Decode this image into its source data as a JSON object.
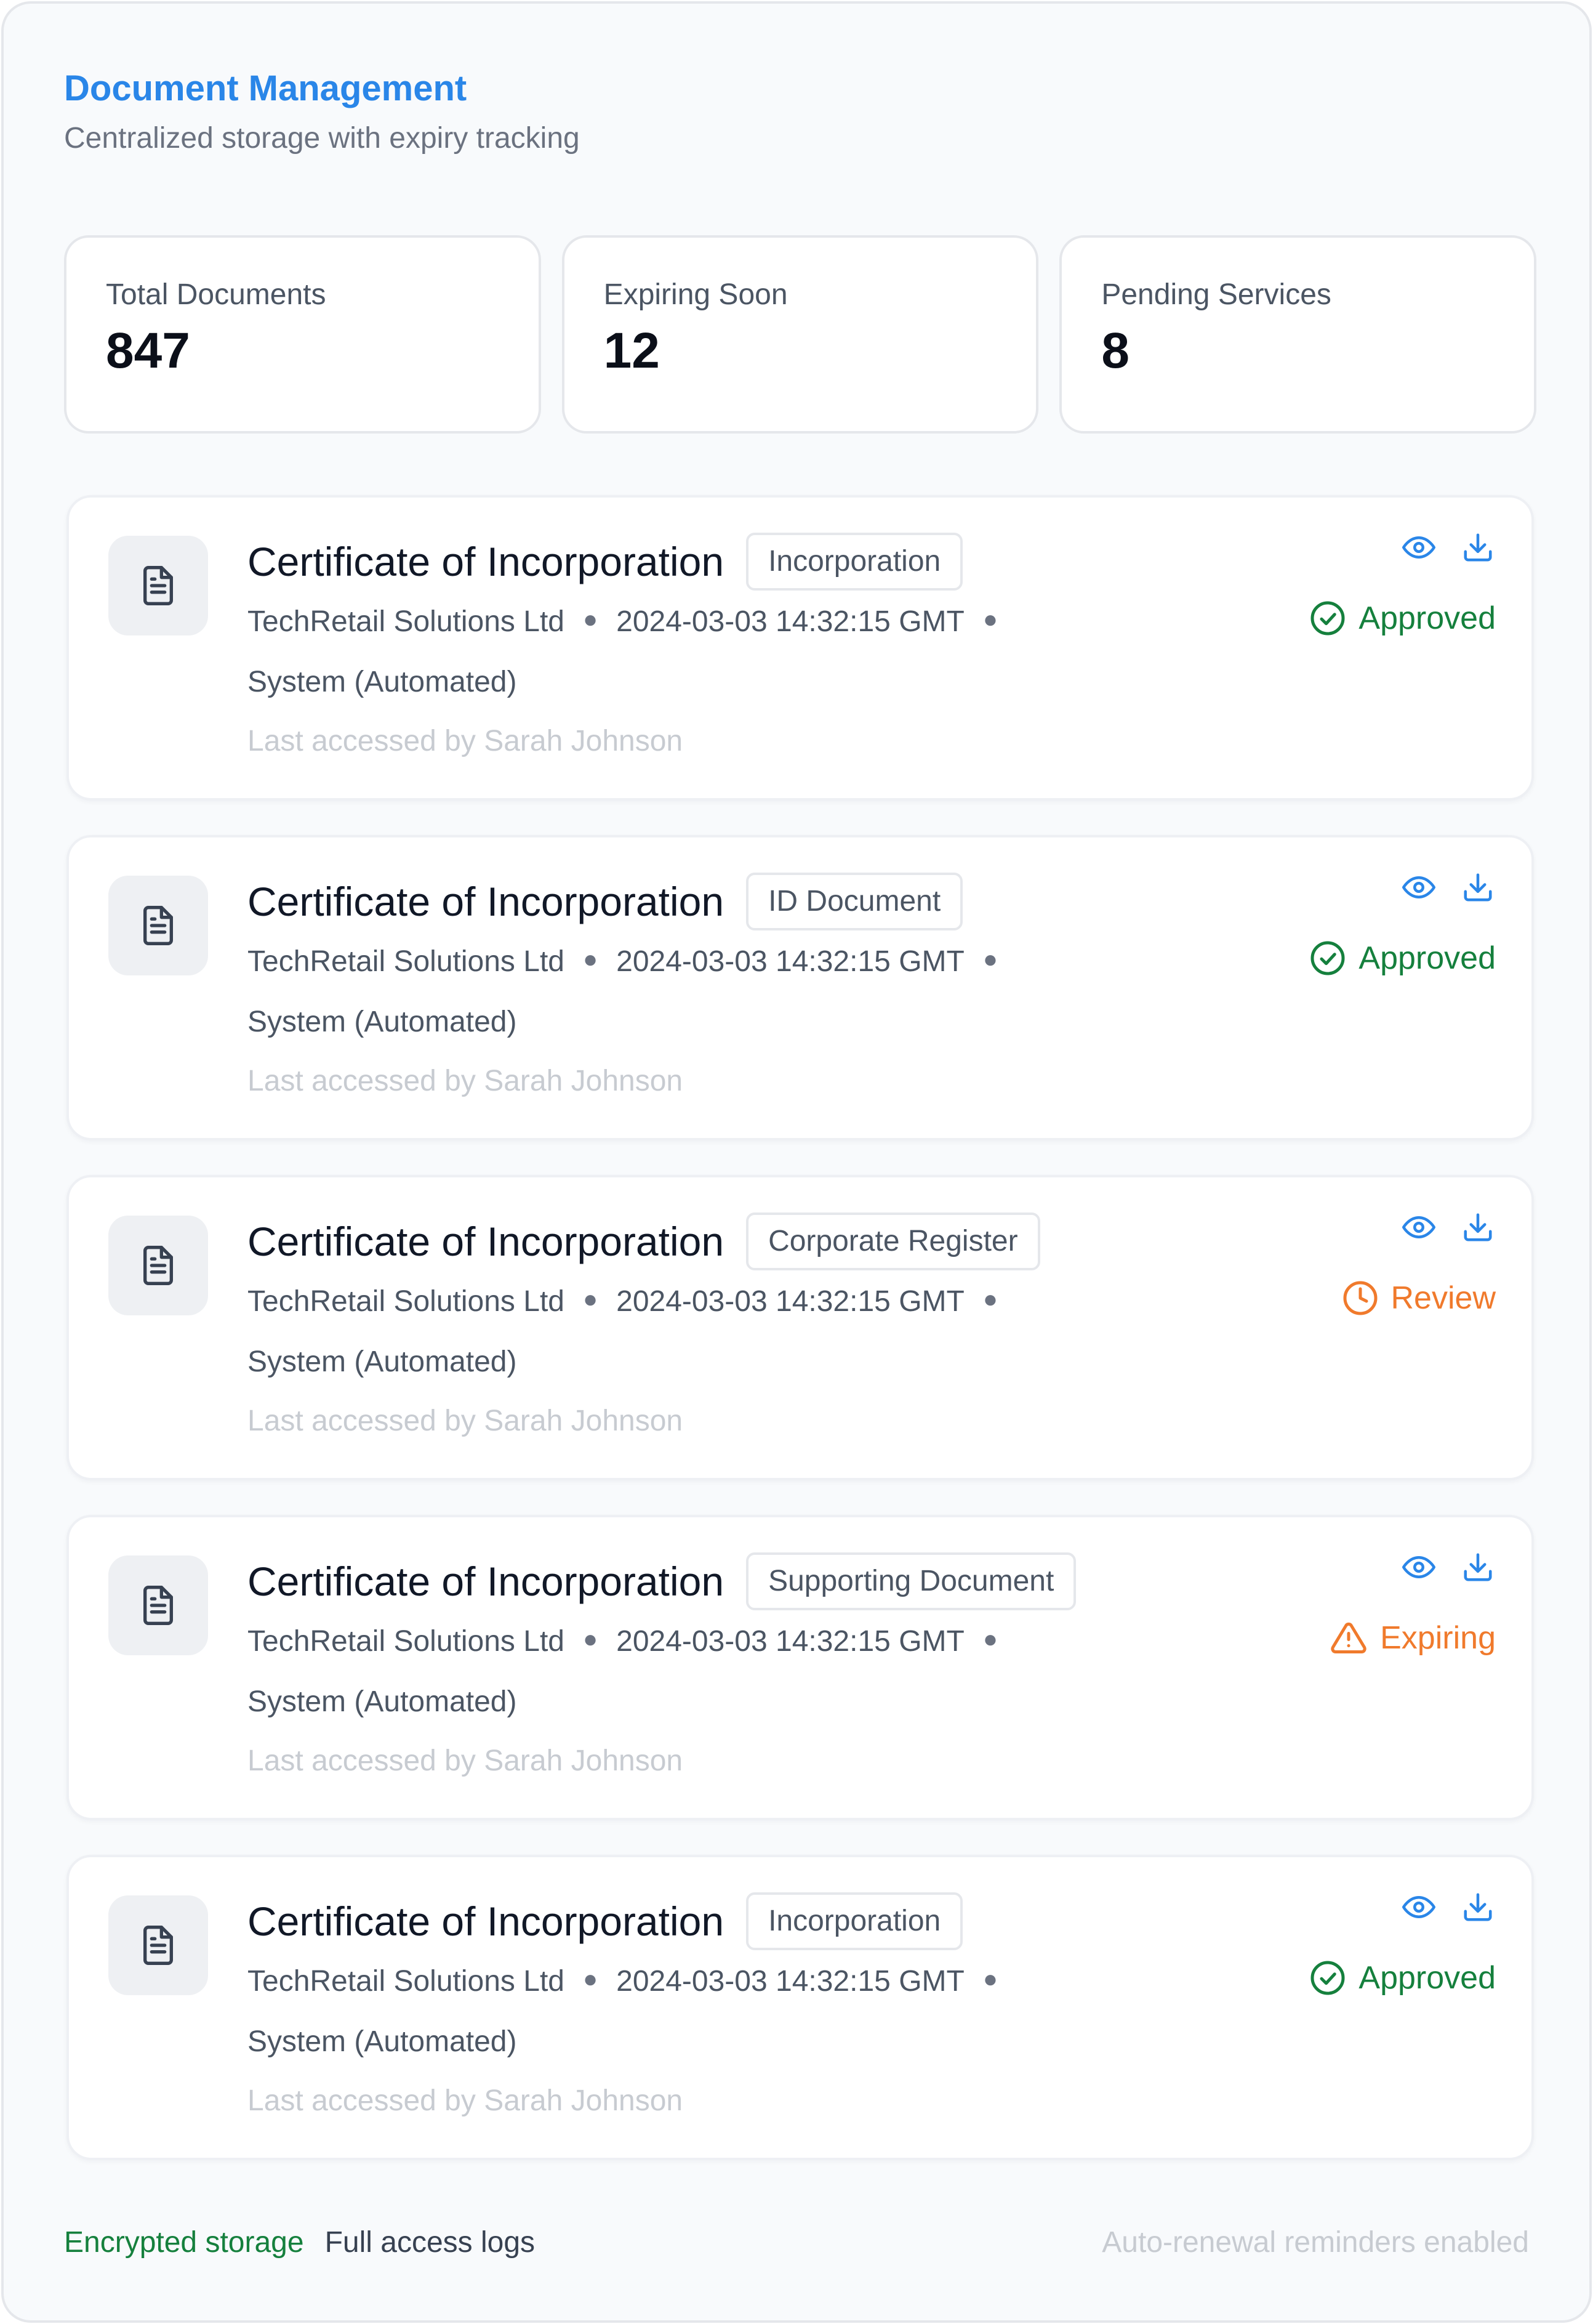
{
  "header": {
    "title": "Document Management",
    "subtitle": "Centralized storage with expiry tracking"
  },
  "stats": [
    {
      "label": "Total Documents",
      "value": "847"
    },
    {
      "label": "Expiring Soon",
      "value": "12"
    },
    {
      "label": "Pending Services",
      "value": "8"
    }
  ],
  "documents": [
    {
      "title": "Certificate of Incorporation",
      "tag": "Incorporation",
      "company": "TechRetail Solutions Ltd",
      "timestamp": "2024-03-03 14:32:15 GMT",
      "source": "System (Automated)",
      "accessed": "Last accessed by Sarah Johnson",
      "status": "Approved",
      "status_type": "approved"
    },
    {
      "title": "Certificate of Incorporation",
      "tag": "ID Document",
      "company": "TechRetail Solutions Ltd",
      "timestamp": "2024-03-03 14:32:15 GMT",
      "source": "System (Automated)",
      "accessed": "Last accessed by Sarah Johnson",
      "status": "Approved",
      "status_type": "approved"
    },
    {
      "title": "Certificate of Incorporation",
      "tag": "Corporate Register",
      "company": "TechRetail Solutions Ltd",
      "timestamp": "2024-03-03 14:32:15 GMT",
      "source": "System (Automated)",
      "accessed": "Last accessed by Sarah Johnson",
      "status": "Review",
      "status_type": "review"
    },
    {
      "title": "Certificate of Incorporation",
      "tag": "Supporting Document",
      "company": "TechRetail Solutions Ltd",
      "timestamp": "2024-03-03 14:32:15 GMT",
      "source": "System (Automated)",
      "accessed": "Last accessed by Sarah Johnson",
      "status": "Expiring",
      "status_type": "expiring"
    },
    {
      "title": "Certificate of Incorporation",
      "tag": "Incorporation",
      "company": "TechRetail Solutions Ltd",
      "timestamp": "2024-03-03 14:32:15 GMT",
      "source": "System (Automated)",
      "accessed": "Last accessed by Sarah Johnson",
      "status": "Approved",
      "status_type": "approved"
    }
  ],
  "icons": {
    "document": "file-text-icon",
    "view": "eye-icon",
    "download": "download-icon",
    "approved": "check-circle-icon",
    "review": "clock-icon",
    "expiring": "warning-triangle-icon"
  },
  "colors": {
    "accent": "#2a86e8",
    "approved": "#15803d",
    "warning": "#f07a2c"
  },
  "footer": {
    "encrypted": "Encrypted storage",
    "logs": "Full access logs",
    "reminders": "Auto-renewal reminders enabled"
  }
}
